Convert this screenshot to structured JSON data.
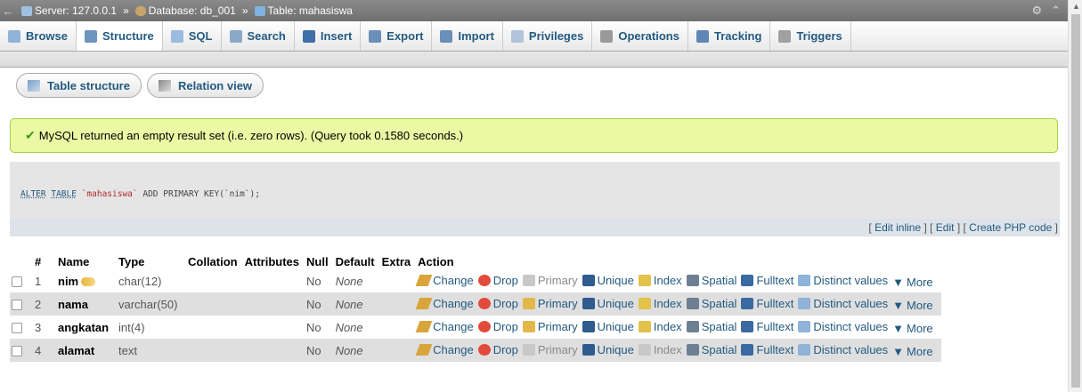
{
  "breadcrumb": {
    "server": "Server: 127.0.0.1",
    "database": "Database: db_001",
    "table": "Table: mahasiswa"
  },
  "tabs": [
    {
      "label": "Browse",
      "icon": "browse-icon"
    },
    {
      "label": "Structure",
      "icon": "structure-icon",
      "active": true
    },
    {
      "label": "SQL",
      "icon": "sql-icon"
    },
    {
      "label": "Search",
      "icon": "search-icon"
    },
    {
      "label": "Insert",
      "icon": "insert-icon"
    },
    {
      "label": "Export",
      "icon": "export-icon"
    },
    {
      "label": "Import",
      "icon": "import-icon"
    },
    {
      "label": "Privileges",
      "icon": "privileges-icon"
    },
    {
      "label": "Operations",
      "icon": "operations-icon"
    },
    {
      "label": "Tracking",
      "icon": "tracking-icon"
    },
    {
      "label": "Triggers",
      "icon": "triggers-icon"
    }
  ],
  "subtabs": {
    "table_structure": "Table structure",
    "relation_view": "Relation view"
  },
  "message": "MySQL returned an empty result set (i.e. zero rows). (Query took 0.1580 seconds.)",
  "sql": {
    "alter": "ALTER",
    "table": "TABLE",
    "name": "`mahasiswa`",
    "add": "ADD",
    "primary": "PRIMARY",
    "key": "KEY",
    "arg": "(`nim`)",
    "semicolon": ";"
  },
  "sql_links": {
    "edit_inline": "Edit inline",
    "edit": "Edit",
    "create_php": "Create PHP code"
  },
  "columns": [
    "#",
    "Name",
    "Type",
    "Collation",
    "Attributes",
    "Null",
    "Default",
    "Extra",
    "Action"
  ],
  "rows": [
    {
      "num": "1",
      "name": "nim",
      "type": "char(12)",
      "null": "No",
      "default": "None",
      "primary": true
    },
    {
      "num": "2",
      "name": "nama",
      "type": "varchar(50)",
      "null": "No",
      "default": "None",
      "primary": false
    },
    {
      "num": "3",
      "name": "angkatan",
      "type": "int(4)",
      "null": "No",
      "default": "None",
      "primary": false
    },
    {
      "num": "4",
      "name": "alamat",
      "type": "text",
      "null": "No",
      "default": "None",
      "primary": false
    }
  ],
  "actions": {
    "change": "Change",
    "drop": "Drop",
    "primary": "Primary",
    "unique": "Unique",
    "index": "Index",
    "spatial": "Spatial",
    "fulltext": "Fulltext",
    "distinct": "Distinct values",
    "more": "More"
  }
}
